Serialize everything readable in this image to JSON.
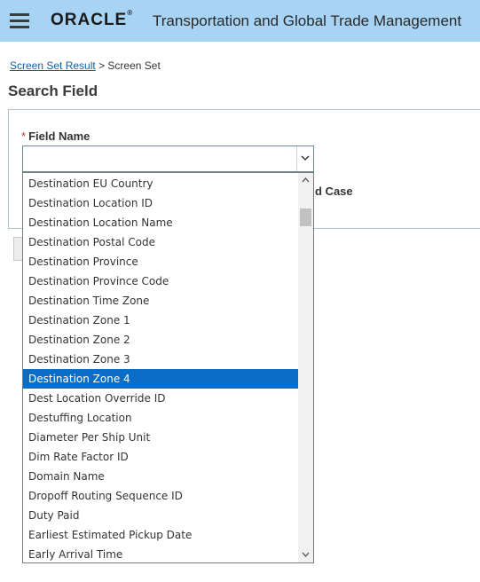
{
  "header": {
    "brand": "ORACLE",
    "app_title": "Transportation and Global Trade Management",
    "menu_icon": "hamburger-menu-icon",
    "background": "#a7d3f4"
  },
  "breadcrumb": {
    "link": "Screen Set Result",
    "separator": ">",
    "current": "Screen Set"
  },
  "page": {
    "title": "Search Field"
  },
  "form": {
    "required_marker": "*",
    "field_label": "Field Name",
    "field_value": "",
    "match_case_label": "d Case"
  },
  "dropdown": {
    "selected": "Destination Zone 4",
    "selected_color": "#0a6dc8",
    "items": [
      "Destination EU Country",
      "Destination Location ID",
      "Destination Location Name",
      "Destination Postal Code",
      "Destination Province",
      "Destination Province Code",
      "Destination Time Zone",
      "Destination Zone 1",
      "Destination Zone 2",
      "Destination Zone 3",
      "Destination Zone 4",
      "Dest Location Override ID",
      "Destuffing Location",
      "Diameter Per Ship Unit",
      "Dim Rate Factor ID",
      "Domain Name",
      "Dropoff Routing Sequence ID",
      "Duty Paid",
      "Earliest Estimated Pickup Date",
      "Early Arrival Time"
    ]
  }
}
